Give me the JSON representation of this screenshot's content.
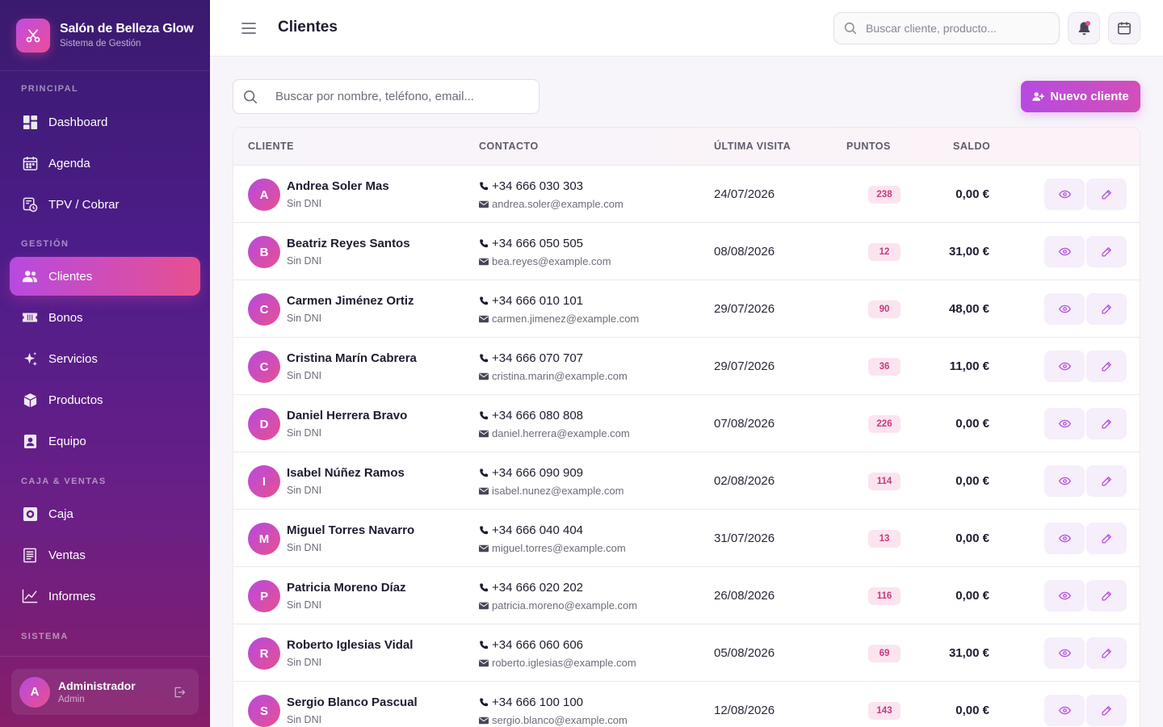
{
  "brand": {
    "title": "Salón de Belleza Glow",
    "subtitle": "Sistema de Gestión"
  },
  "sidebar": {
    "sections": [
      {
        "label": "PRINCIPAL"
      },
      {
        "label": "GESTIÓN"
      },
      {
        "label": "CAJA & VENTAS"
      },
      {
        "label": "SISTEMA"
      }
    ],
    "items": [
      {
        "label": "Dashboard",
        "icon": "dashboard-icon"
      },
      {
        "label": "Agenda",
        "icon": "calendar-icon"
      },
      {
        "label": "TPV / Cobrar",
        "icon": "pos-icon"
      },
      {
        "label": "Clientes",
        "icon": "users-icon",
        "active": true
      },
      {
        "label": "Bonos",
        "icon": "ticket-icon"
      },
      {
        "label": "Servicios",
        "icon": "sparkles-icon"
      },
      {
        "label": "Productos",
        "icon": "box-icon"
      },
      {
        "label": "Equipo",
        "icon": "id-badge-icon"
      },
      {
        "label": "Caja",
        "icon": "cash-register-icon"
      },
      {
        "label": "Ventas",
        "icon": "receipt-icon"
      },
      {
        "label": "Informes",
        "icon": "chart-line-icon"
      }
    ],
    "user": {
      "initial": "A",
      "name": "Administrador",
      "role": "Admin"
    }
  },
  "topbar": {
    "title": "Clientes",
    "search_placeholder": "Buscar cliente, producto..."
  },
  "main": {
    "search_placeholder": "Buscar por nombre, teléfono, email...",
    "new_button": "Nuevo cliente",
    "columns": [
      "CLIENTE",
      "CONTACTO",
      "ÚLTIMA VISITA",
      "PUNTOS",
      "SALDO"
    ],
    "rows": [
      {
        "initial": "A",
        "name": "Andrea Soler Mas",
        "dni": "Sin DNI",
        "phone": "+34 666 030 303",
        "email": "andrea.soler@example.com",
        "last_visit": "24/07/2026",
        "points": "238",
        "balance": "0,00 €"
      },
      {
        "initial": "B",
        "name": "Beatriz Reyes Santos",
        "dni": "Sin DNI",
        "phone": "+34 666 050 505",
        "email": "bea.reyes@example.com",
        "last_visit": "08/08/2026",
        "points": "12",
        "balance": "31,00 €"
      },
      {
        "initial": "C",
        "name": "Carmen Jiménez Ortiz",
        "dni": "Sin DNI",
        "phone": "+34 666 010 101",
        "email": "carmen.jimenez@example.com",
        "last_visit": "29/07/2026",
        "points": "90",
        "balance": "48,00 €"
      },
      {
        "initial": "C",
        "name": "Cristina Marín Cabrera",
        "dni": "Sin DNI",
        "phone": "+34 666 070 707",
        "email": "cristina.marin@example.com",
        "last_visit": "29/07/2026",
        "points": "36",
        "balance": "11,00 €"
      },
      {
        "initial": "D",
        "name": "Daniel Herrera Bravo",
        "dni": "Sin DNI",
        "phone": "+34 666 080 808",
        "email": "daniel.herrera@example.com",
        "last_visit": "07/08/2026",
        "points": "226",
        "balance": "0,00 €"
      },
      {
        "initial": "I",
        "name": "Isabel Núñez Ramos",
        "dni": "Sin DNI",
        "phone": "+34 666 090 909",
        "email": "isabel.nunez@example.com",
        "last_visit": "02/08/2026",
        "points": "114",
        "balance": "0,00 €"
      },
      {
        "initial": "M",
        "name": "Miguel Torres Navarro",
        "dni": "Sin DNI",
        "phone": "+34 666 040 404",
        "email": "miguel.torres@example.com",
        "last_visit": "31/07/2026",
        "points": "13",
        "balance": "0,00 €"
      },
      {
        "initial": "P",
        "name": "Patricia Moreno Díaz",
        "dni": "Sin DNI",
        "phone": "+34 666 020 202",
        "email": "patricia.moreno@example.com",
        "last_visit": "26/08/2026",
        "points": "116",
        "balance": "0,00 €"
      },
      {
        "initial": "R",
        "name": "Roberto Iglesias Vidal",
        "dni": "Sin DNI",
        "phone": "+34 666 060 606",
        "email": "roberto.iglesias@example.com",
        "last_visit": "05/08/2026",
        "points": "69",
        "balance": "31,00 €"
      },
      {
        "initial": "S",
        "name": "Sergio Blanco Pascual",
        "dni": "Sin DNI",
        "phone": "+34 666 100 100",
        "email": "sergio.blanco@example.com",
        "last_visit": "12/08/2026",
        "points": "143",
        "balance": "0,00 €"
      }
    ]
  },
  "colors": {
    "accent": "#b74ae0",
    "accent2": "#e7508f",
    "sidebar_top": "#3a1a6e",
    "sidebar_bottom": "#861e6a"
  }
}
